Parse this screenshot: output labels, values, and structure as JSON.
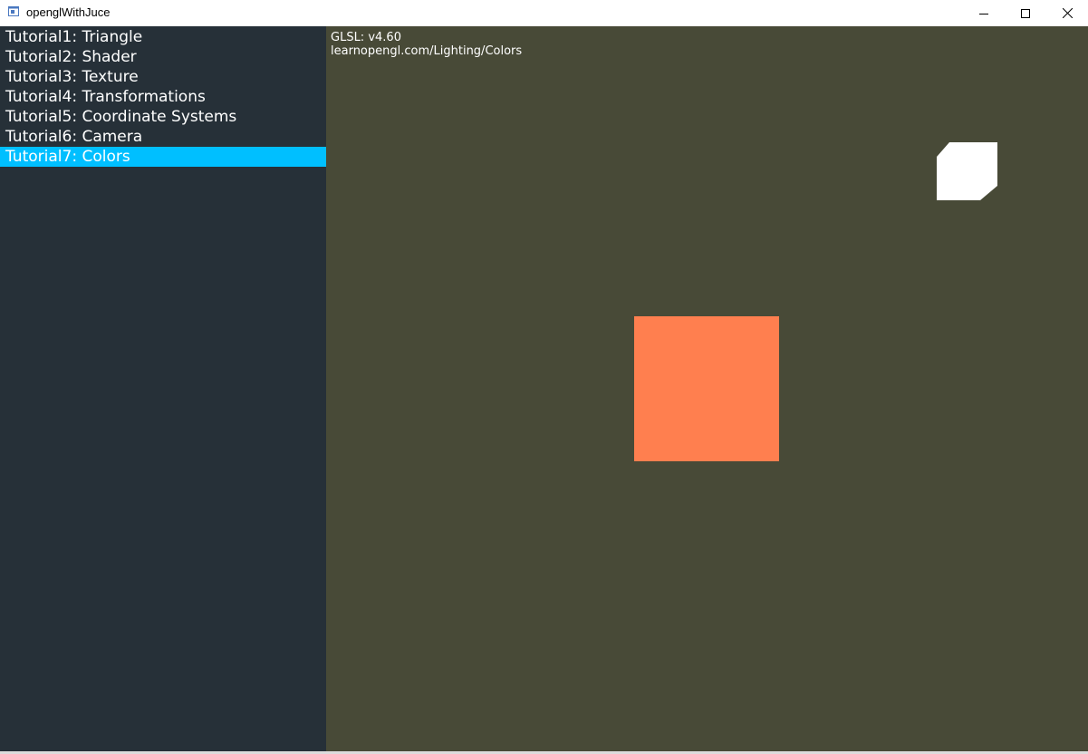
{
  "window": {
    "title": "openglWithJuce",
    "controls": [
      "minimize",
      "maximize",
      "close"
    ]
  },
  "sidebar": {
    "items": [
      {
        "label": "Tutorial1: Triangle",
        "selected": false
      },
      {
        "label": "Tutorial2: Shader",
        "selected": false
      },
      {
        "label": "Tutorial3: Texture",
        "selected": false
      },
      {
        "label": "Tutorial4: Transformations",
        "selected": false
      },
      {
        "label": "Tutorial5: Coordinate Systems",
        "selected": false
      },
      {
        "label": "Tutorial6: Camera",
        "selected": false
      },
      {
        "label": "Tutorial7: Colors",
        "selected": true
      }
    ]
  },
  "gl_view": {
    "glsl_version": "GLSL: v4.60",
    "source_url": "learnopengl.com/Lighting/Colors"
  },
  "colors": {
    "sidebar_bg": "#263038",
    "selected_bg": "#00bfff",
    "gl_bg": "#484a37",
    "object_color": "#ff7f4f",
    "lamp_color": "#ffffff"
  }
}
